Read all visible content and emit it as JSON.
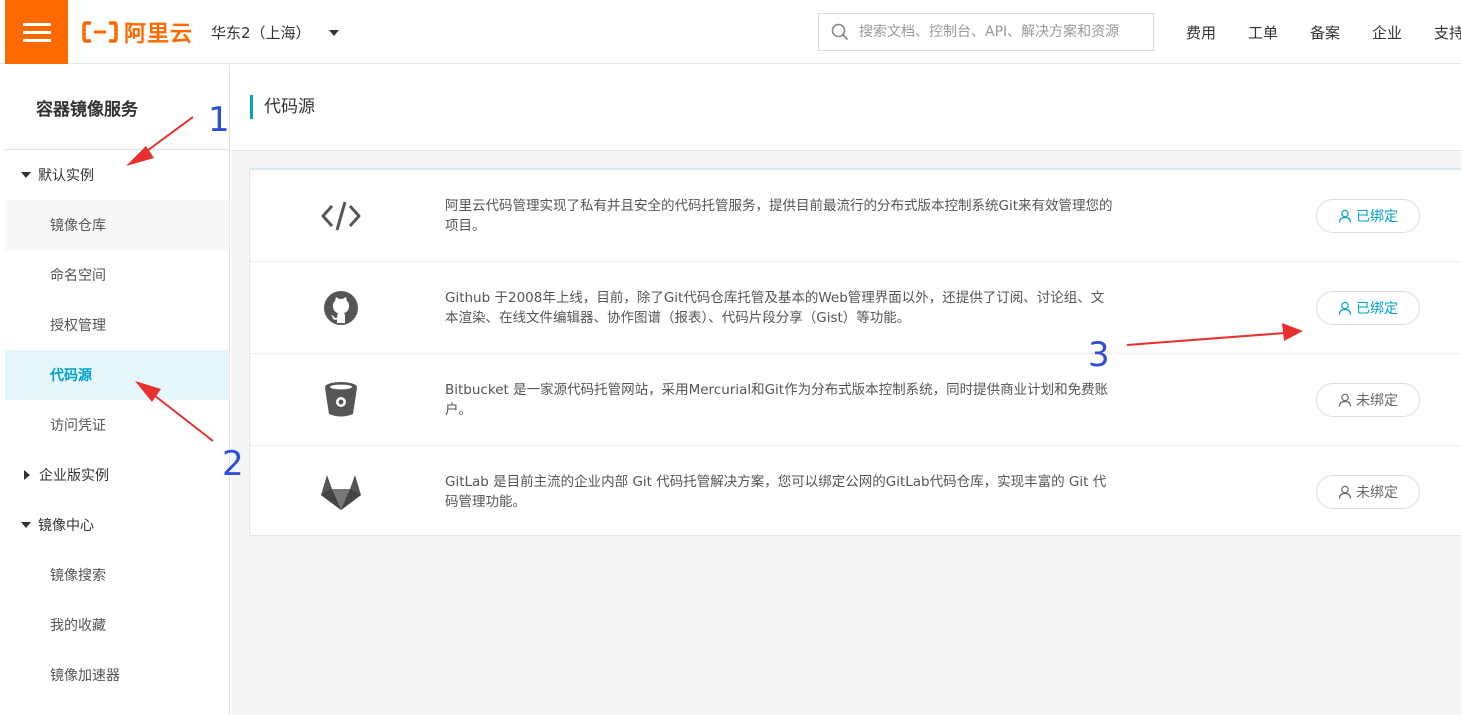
{
  "header": {
    "logo_text": "阿里云",
    "region": "华东2（上海）",
    "search_placeholder": "搜索文档、控制台、API、解决方案和资源",
    "nav": [
      "费用",
      "工单",
      "备案",
      "企业",
      "支持"
    ]
  },
  "sidebar": {
    "title": "容器镜像服务",
    "groups": [
      {
        "label": "默认实例",
        "expanded": true,
        "items": [
          "镜像仓库",
          "命名空间",
          "授权管理",
          "代码源",
          "访问凭证"
        ]
      },
      {
        "label": "企业版实例",
        "expanded": false,
        "items": []
      },
      {
        "label": "镜像中心",
        "expanded": true,
        "items": [
          "镜像搜索",
          "我的收藏",
          "镜像加速器"
        ]
      }
    ],
    "active_item": "代码源"
  },
  "page": {
    "title": "代码源"
  },
  "sources": [
    {
      "icon": "code-icon",
      "description": "阿里云代码管理实现了私有并且安全的代码托管服务，提供目前最流行的分布式版本控制系统Git来有效管理您的项目。",
      "status": "已绑定",
      "bound": true
    },
    {
      "icon": "github-icon",
      "description": "Github 于2008年上线，目前，除了Git代码仓库托管及基本的Web管理界面以外，还提供了订阅、讨论组、文本渲染、在线文件编辑器、协作图谱（报表）、代码片段分享（Gist）等功能。",
      "status": "已绑定",
      "bound": true
    },
    {
      "icon": "bitbucket-icon",
      "description": "Bitbucket 是一家源代码托管网站，采用Mercurial和Git作为分布式版本控制系统，同时提供商业计划和免费账户。",
      "status": "未绑定",
      "bound": false
    },
    {
      "icon": "gitlab-icon",
      "description": "GitLab 是目前主流的企业内部 Git 代码托管解决方案，您可以绑定公网的GitLab代码仓库，实现丰富的 Git 代码管理功能。",
      "status": "未绑定",
      "bound": false
    }
  ],
  "annotations": [
    "1",
    "2",
    "3"
  ],
  "colors": {
    "brand": "#ff6a00",
    "accent": "#00a2ca",
    "annotation_arrow": "#e8312f",
    "annotation_number": "#2f4fd6"
  }
}
